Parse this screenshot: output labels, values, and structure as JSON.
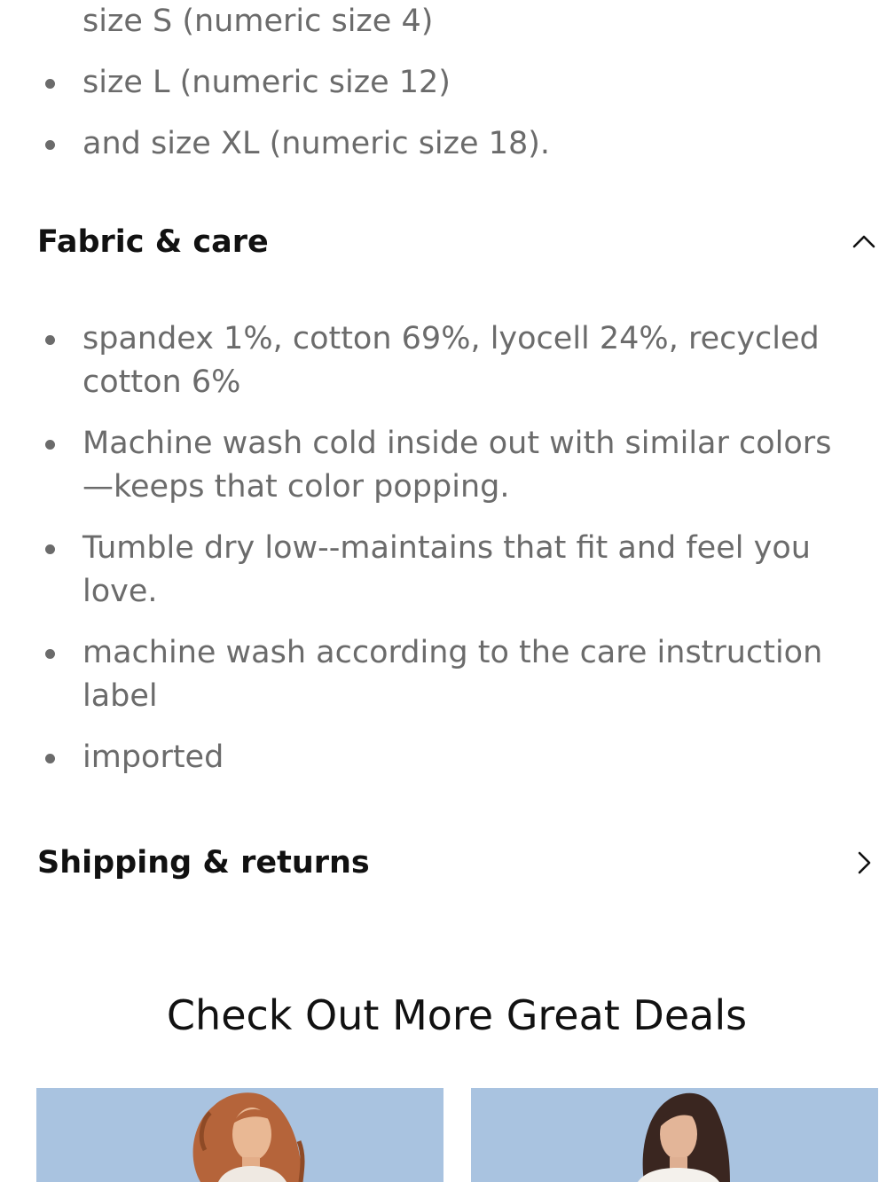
{
  "size_list": {
    "continuation": "size S (numeric size 4)",
    "items": [
      "size L (numeric size 12)",
      "and size XL (numeric size 18)."
    ]
  },
  "fabric_care": {
    "title": "Fabric & care",
    "expanded": true,
    "icon": "chevron-up-icon",
    "items": [
      "spandex 1%, cotton 69%, lyocell 24%, recycled cotton 6%",
      "Machine wash cold inside out with similar colors —keeps that color popping.",
      "Tumble dry low--maintains that fit and feel you love.",
      "machine wash according to the care instruction label",
      "imported"
    ]
  },
  "shipping_returns": {
    "title": "Shipping & returns",
    "expanded": false,
    "icon": "chevron-right-icon"
  },
  "deals": {
    "title": "Check Out More Great Deals",
    "cards": [
      {
        "image": "model-curly-hair-photo",
        "background": "#a9c3e0"
      },
      {
        "image": "model-dark-hair-photo",
        "background": "#a9c3e0"
      }
    ]
  },
  "colors": {
    "body_text": "#6b6b6b",
    "heading_text": "#111111",
    "card_background": "#a9c3e0"
  }
}
